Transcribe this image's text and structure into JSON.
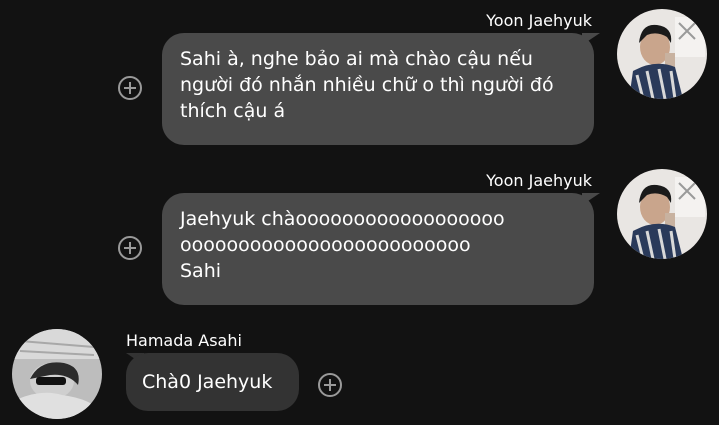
{
  "messages": [
    {
      "sender": "Yoon Jaehyuk",
      "direction": "outgoing",
      "lines": [
        "Sahi à, nghe bảo ai mà chào cậu nếu",
        "người đó nhắn nhiều chữ o thì người đó",
        "thích cậu á"
      ],
      "avatar_icon": "user-avatar-photo"
    },
    {
      "sender": "Yoon Jaehyuk",
      "direction": "outgoing",
      "lines": [
        "Jaehyuk chàoooooooooooooooooo",
        "ooooooooooooooooooooooooo",
        "Sahi"
      ],
      "avatar_icon": "user-avatar-photo"
    },
    {
      "sender": "Hamada Asahi",
      "direction": "incoming",
      "lines": [
        "Chà0 Jaehyuk"
      ],
      "avatar_icon": "user-avatar-photo"
    }
  ],
  "icons": {
    "add_reaction": "add-circle-icon"
  },
  "colors": {
    "background": "#121212",
    "outgoing_bubble": "#4a4a4a",
    "incoming_bubble": "#333333",
    "icon": "#9a9a9a"
  }
}
